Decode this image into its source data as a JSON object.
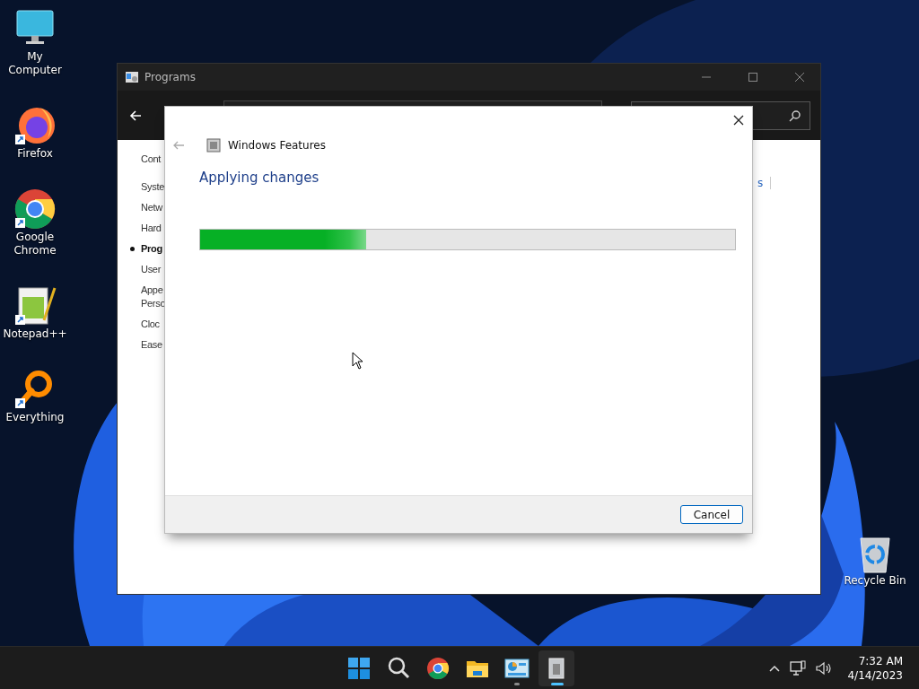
{
  "desktop_icons": [
    {
      "kind": "computer",
      "label": "My Computer",
      "shortcut": false
    },
    {
      "kind": "firefox",
      "label": "Firefox",
      "shortcut": true
    },
    {
      "kind": "chrome",
      "label": "Google Chrome",
      "shortcut": true
    },
    {
      "kind": "notepad",
      "label": "Notepad++",
      "shortcut": true
    },
    {
      "kind": "everything",
      "label": "Everything",
      "shortcut": true
    }
  ],
  "recycle_bin": {
    "label": "Recycle Bin"
  },
  "programs_window": {
    "title": "Programs",
    "sidebar": [
      {
        "label": "Cont",
        "selected": false
      },
      {
        "label": "Syste",
        "selected": false
      },
      {
        "label": "Netw",
        "selected": false
      },
      {
        "label": "Hard",
        "selected": false
      },
      {
        "label": "Prog",
        "selected": true
      },
      {
        "label": "User",
        "selected": false
      },
      {
        "label": "Appe\nPerso",
        "selected": false
      },
      {
        "label": "Cloc",
        "selected": false
      },
      {
        "label": "Ease",
        "selected": false
      }
    ],
    "link_fragment": "s"
  },
  "dialog": {
    "title": "Windows Features",
    "heading": "Applying changes",
    "progress": {
      "level": 0.31
    },
    "buttons": [
      "Cancel"
    ]
  },
  "taskbar": {
    "apps": [
      {
        "kind": "start",
        "running": false,
        "active": false
      },
      {
        "kind": "search",
        "running": false,
        "active": false
      },
      {
        "kind": "chrome",
        "running": false,
        "active": false
      },
      {
        "kind": "folder",
        "running": false,
        "active": false
      },
      {
        "kind": "control-panel",
        "running": true,
        "active": false
      },
      {
        "kind": "features",
        "running": true,
        "active": true
      }
    ],
    "time": "7:32 AM",
    "date": "4/14/2023"
  }
}
